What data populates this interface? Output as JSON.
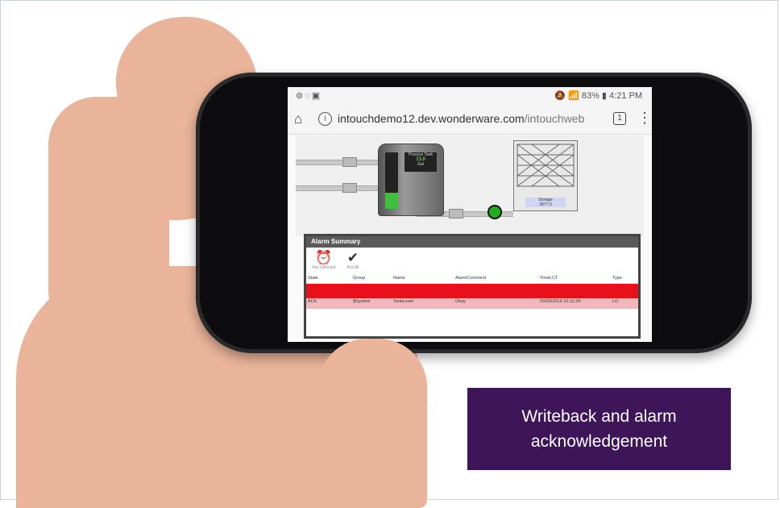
{
  "statusbar": {
    "left_icons": "⊚◌▣",
    "right": "🔕 📶 83% ▮ 4:21 PM"
  },
  "browser": {
    "home_icon": "⌂",
    "info_icon": "i",
    "url_host": "intouchdemo12.dev.wonderware.com",
    "url_path": "/intouchweb",
    "tab_count": "1",
    "menu_icon": "⋮"
  },
  "scada": {
    "tank_title": "Process Tank",
    "tank_value": "23.8",
    "tank_unit": "Gal",
    "storage_label": "Storage",
    "storage_value": "2877.0"
  },
  "alarm_summary": {
    "title": "Alarm Summary",
    "buttons": [
      {
        "label": "Ack Selected",
        "icon": "alarm-clock-check-icon"
      },
      {
        "label": "Ack All",
        "icon": "double-check-icon"
      }
    ],
    "columns": [
      "State",
      "Group",
      "Name",
      "AlarmComment",
      "TimeLCT",
      "Type"
    ],
    "rows": [
      {
        "state": "",
        "group": "",
        "name": "",
        "comment": "",
        "time": "",
        "type": ""
      },
      {
        "state": "ACK",
        "group": "$System",
        "name": "TankLevel",
        "comment": "Okay",
        "time": "03/26/2019 16:12:24",
        "type": "LO"
      }
    ]
  },
  "caption": {
    "line1": "Writeback and alarm",
    "line2": "acknowledgement"
  },
  "colors": {
    "caption_bg": "#3d1558",
    "alarm_active": "#e8101a",
    "alarm_acked": "#f1b8bb"
  }
}
